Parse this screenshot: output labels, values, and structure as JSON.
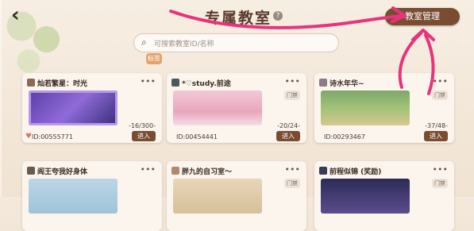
{
  "header": {
    "back_icon": "chevron-left-icon",
    "title": "专属教室",
    "help_icon": "question-circle-icon",
    "manage_label": "教室管理"
  },
  "search": {
    "icon": "search-icon",
    "placeholder": "可搜索教室ID/名称"
  },
  "tag_label": "标签",
  "rooms": [
    {
      "title": "灿若繁星：时光",
      "count": "-16/300-",
      "id": "ID:00555771",
      "enter": "进入",
      "badge": "",
      "theme": "purple"
    },
    {
      "title": "*♡study.前途",
      "count": "-20/24-",
      "id": "ID:00454441",
      "enter": "进入",
      "badge": "门禁",
      "theme": "pink"
    },
    {
      "title": "诗水年华~",
      "count": "-37/48-",
      "id": "ID:00293467",
      "enter": "进入",
      "badge": "门禁",
      "theme": "green"
    },
    {
      "title": "阎王夸我好身体",
      "badge": "",
      "theme": "blue"
    },
    {
      "title": "胖九的自习室～",
      "badge": "门禁",
      "theme": "tan"
    },
    {
      "title": "前程似锦 (奖励)",
      "badge": "门禁",
      "theme": "dark"
    }
  ],
  "colors": {
    "accent": "#7a4d33",
    "annotation": "#e8337c"
  }
}
